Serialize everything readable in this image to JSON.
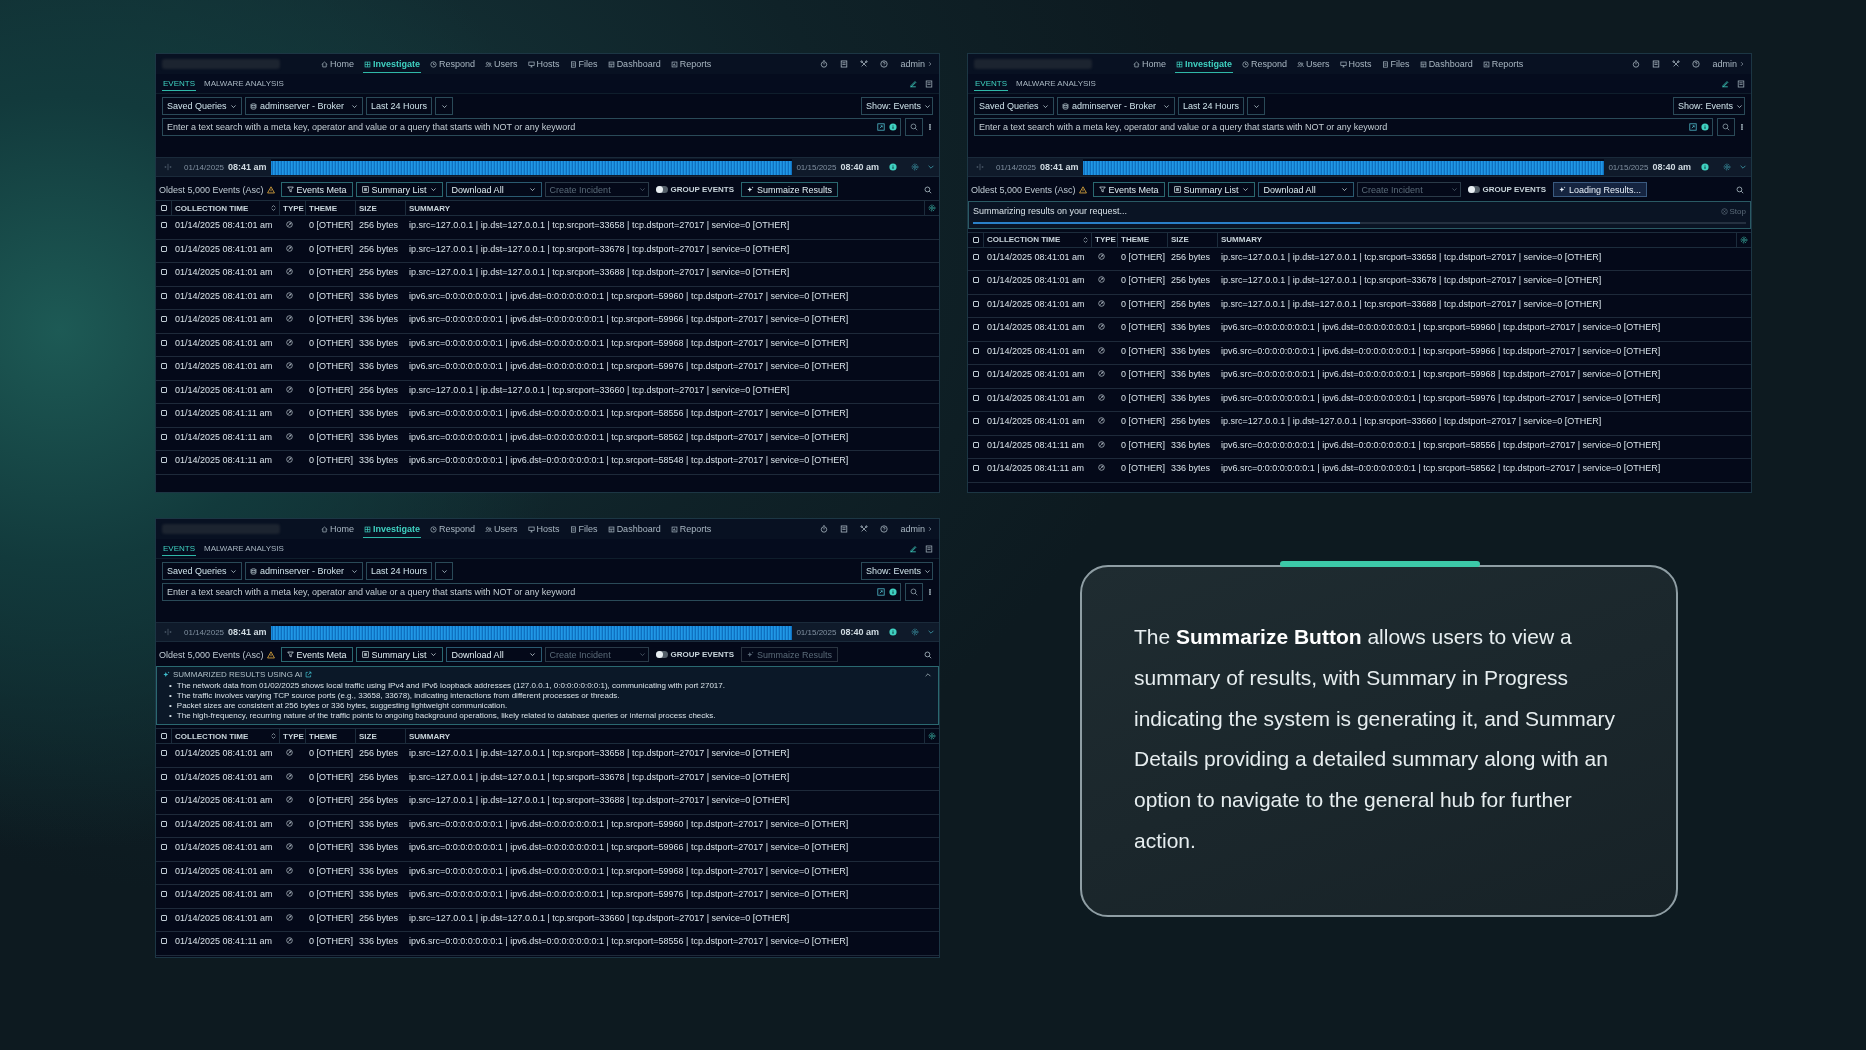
{
  "panels": [
    {
      "nav": {
        "items": [
          {
            "label": "Home",
            "selected": false
          },
          {
            "label": "Investigate",
            "selected": true
          },
          {
            "label": "Respond",
            "selected": false
          },
          {
            "label": "Users",
            "selected": false
          },
          {
            "label": "Hosts",
            "selected": false
          },
          {
            "label": "Files",
            "selected": false
          },
          {
            "label": "Dashboard",
            "selected": false
          },
          {
            "label": "Reports",
            "selected": false
          }
        ],
        "user": "admin"
      },
      "subtabs": [
        {
          "label": "EVENTS",
          "selected": true
        },
        {
          "label": "MALWARE ANALYSIS",
          "selected": false
        }
      ],
      "filters": {
        "saved_queries": "Saved Queries",
        "service": "adminserver - Broker",
        "range": "Last 24 Hours",
        "show": "Show: Events"
      },
      "search": {
        "placeholder": "Enter a text search with a meta key, operator and value or a query that starts with NOT or any keyword"
      },
      "timeline": {
        "start_date": "01/14/2025",
        "start_time": "08:41 am",
        "end_date": "01/15/2025",
        "end_time": "08:40 am"
      },
      "toolbar": {
        "count": "Oldest 5,000 Events (Asc)",
        "events_meta": "Events Meta",
        "summary_list": "Summary List",
        "download": "Download All",
        "incident_placeholder": "Create Incident",
        "group_events": {
          "label": "GROUP EVENTS",
          "on": false
        },
        "summarize": {
          "label": "Summaize Results",
          "kind": "idle"
        }
      },
      "select_all_checked": false,
      "columns": [
        "COLLECTION TIME",
        "TYPE",
        "THEME",
        "SIZE",
        "SUMMARY"
      ],
      "rows": [
        {
          "checked": false,
          "time": "01/14/2025 08:41:01 am",
          "theme": "0 [OTHER]",
          "size": "256 bytes",
          "summary": "ip.src=127.0.0.1 |  ip.dst=127.0.0.1 |  tcp.srcport=33658 |  tcp.dstport=27017 |  service=0 [OTHER]"
        },
        {
          "checked": false,
          "time": "01/14/2025 08:41:01 am",
          "theme": "0 [OTHER]",
          "size": "256 bytes",
          "summary": "ip.src=127.0.0.1 |  ip.dst=127.0.0.1 |  tcp.srcport=33678 |  tcp.dstport=27017 |  service=0 [OTHER]"
        },
        {
          "checked": false,
          "time": "01/14/2025 08:41:01 am",
          "theme": "0 [OTHER]",
          "size": "256 bytes",
          "summary": "ip.src=127.0.0.1 |  ip.dst=127.0.0.1 |  tcp.srcport=33688 |  tcp.dstport=27017 |  service=0 [OTHER]"
        },
        {
          "checked": false,
          "time": "01/14/2025 08:41:01 am",
          "theme": "0 [OTHER]",
          "size": "336 bytes",
          "summary": "ipv6.src=0:0:0:0:0:0:0:1 |  ipv6.dst=0:0:0:0:0:0:0:1 |  tcp.srcport=59960 |  tcp.dstport=27017 |  service=0 [OTHER]"
        },
        {
          "checked": false,
          "time": "01/14/2025 08:41:01 am",
          "theme": "0 [OTHER]",
          "size": "336 bytes",
          "summary": "ipv6.src=0:0:0:0:0:0:0:1 |  ipv6.dst=0:0:0:0:0:0:0:1 |  tcp.srcport=59966 |  tcp.dstport=27017 |  service=0 [OTHER]"
        },
        {
          "checked": false,
          "time": "01/14/2025 08:41:01 am",
          "theme": "0 [OTHER]",
          "size": "336 bytes",
          "summary": "ipv6.src=0:0:0:0:0:0:0:1 |  ipv6.dst=0:0:0:0:0:0:0:1 |  tcp.srcport=59968 |  tcp.dstport=27017 |  service=0 [OTHER]"
        },
        {
          "checked": false,
          "time": "01/14/2025 08:41:01 am",
          "theme": "0 [OTHER]",
          "size": "336 bytes",
          "summary": "ipv6.src=0:0:0:0:0:0:0:1 |  ipv6.dst=0:0:0:0:0:0:0:1 |  tcp.srcport=59976 |  tcp.dstport=27017 |  service=0 [OTHER]"
        },
        {
          "checked": false,
          "time": "01/14/2025 08:41:01 am",
          "theme": "0 [OTHER]",
          "size": "256 bytes",
          "summary": "ip.src=127.0.0.1 |  ip.dst=127.0.0.1 |  tcp.srcport=33660 |  tcp.dstport=27017 |  service=0 [OTHER]"
        },
        {
          "checked": false,
          "time": "01/14/2025 08:41:11 am",
          "theme": "0 [OTHER]",
          "size": "336 bytes",
          "summary": "ipv6.src=0:0:0:0:0:0:0:1 |  ipv6.dst=0:0:0:0:0:0:0:1 |  tcp.srcport=58556 |  tcp.dstport=27017 |  service=0 [OTHER]"
        },
        {
          "checked": false,
          "time": "01/14/2025 08:41:11 am",
          "theme": "0 [OTHER]",
          "size": "336 bytes",
          "summary": "ipv6.src=0:0:0:0:0:0:0:1 |  ipv6.dst=0:0:0:0:0:0:0:1 |  tcp.srcport=58562 |  tcp.dstport=27017 |  service=0 [OTHER]"
        },
        {
          "checked": false,
          "time": "01/14/2025 08:41:11 am",
          "theme": "0 [OTHER]",
          "size": "336 bytes",
          "summary": "ipv6.src=0:0:0:0:0:0:0:1 |  ipv6.dst=0:0:0:0:0:0:0:1 |  tcp.srcport=58548 |  tcp.dstport=27017 |  service=0 [OTHER]"
        }
      ]
    },
    {
      "nav": {
        "items": [
          {
            "label": "Home",
            "selected": false
          },
          {
            "label": "Investigate",
            "selected": true
          },
          {
            "label": "Respond",
            "selected": false
          },
          {
            "label": "Users",
            "selected": false
          },
          {
            "label": "Hosts",
            "selected": false
          },
          {
            "label": "Files",
            "selected": false
          },
          {
            "label": "Dashboard",
            "selected": false
          },
          {
            "label": "Reports",
            "selected": false
          }
        ],
        "user": "admin"
      },
      "subtabs": [
        {
          "label": "EVENTS",
          "selected": true
        },
        {
          "label": "MALWARE ANALYSIS",
          "selected": false
        }
      ],
      "filters": {
        "saved_queries": "Saved Queries",
        "service": "adminserver - Broker",
        "range": "Last 24 Hours",
        "show": "Show: Events"
      },
      "search": {
        "placeholder": "Enter a text search with a meta key, operator and value or a query that starts with NOT or any keyword"
      },
      "timeline": {
        "start_date": "01/14/2025",
        "start_time": "08:41 am",
        "end_date": "01/15/2025",
        "end_time": "08:40 am"
      },
      "toolbar": {
        "count": "Oldest 5,000 Events (Asc)",
        "events_meta": "Events Meta",
        "summary_list": "Summary List",
        "download": "Download All",
        "incident_placeholder": "Create Incident",
        "group_events": {
          "label": "GROUP EVENTS",
          "on": false
        },
        "summarize": {
          "label": "Loading Results...",
          "kind": "loading"
        }
      },
      "progress": {
        "message": "Summarizing results on your request...",
        "stop": "Stop",
        "level": 0.5
      },
      "select_all_checked": false,
      "columns": [
        "COLLECTION TIME",
        "TYPE",
        "THEME",
        "SIZE",
        "SUMMARY"
      ],
      "rows": [
        {
          "checked": false,
          "time": "01/14/2025 08:41:01 am",
          "theme": "0 [OTHER]",
          "size": "256 bytes",
          "summary": "ip.src=127.0.0.1 |  ip.dst=127.0.0.1 |  tcp.srcport=33658 |  tcp.dstport=27017 |  service=0 [OTHER]"
        },
        {
          "checked": false,
          "time": "01/14/2025 08:41:01 am",
          "theme": "0 [OTHER]",
          "size": "256 bytes",
          "summary": "ip.src=127.0.0.1 |  ip.dst=127.0.0.1 |  tcp.srcport=33678 |  tcp.dstport=27017 |  service=0 [OTHER]"
        },
        {
          "checked": false,
          "time": "01/14/2025 08:41:01 am",
          "theme": "0 [OTHER]",
          "size": "256 bytes",
          "summary": "ip.src=127.0.0.1 |  ip.dst=127.0.0.1 |  tcp.srcport=33688 |  tcp.dstport=27017 |  service=0 [OTHER]"
        },
        {
          "checked": false,
          "time": "01/14/2025 08:41:01 am",
          "theme": "0 [OTHER]",
          "size": "336 bytes",
          "summary": "ipv6.src=0:0:0:0:0:0:0:1 |  ipv6.dst=0:0:0:0:0:0:0:1 |  tcp.srcport=59960 |  tcp.dstport=27017 |  service=0 [OTHER]"
        },
        {
          "checked": false,
          "time": "01/14/2025 08:41:01 am",
          "theme": "0 [OTHER]",
          "size": "336 bytes",
          "summary": "ipv6.src=0:0:0:0:0:0:0:1 |  ipv6.dst=0:0:0:0:0:0:0:1 |  tcp.srcport=59966 |  tcp.dstport=27017 |  service=0 [OTHER]"
        },
        {
          "checked": false,
          "time": "01/14/2025 08:41:01 am",
          "theme": "0 [OTHER]",
          "size": "336 bytes",
          "summary": "ipv6.src=0:0:0:0:0:0:0:1 |  ipv6.dst=0:0:0:0:0:0:0:1 |  tcp.srcport=59968 |  tcp.dstport=27017 |  service=0 [OTHER]"
        },
        {
          "checked": false,
          "time": "01/14/2025 08:41:01 am",
          "theme": "0 [OTHER]",
          "size": "336 bytes",
          "summary": "ipv6.src=0:0:0:0:0:0:0:1 |  ipv6.dst=0:0:0:0:0:0:0:1 |  tcp.srcport=59976 |  tcp.dstport=27017 |  service=0 [OTHER]"
        },
        {
          "checked": false,
          "time": "01/14/2025 08:41:01 am",
          "theme": "0 [OTHER]",
          "size": "256 bytes",
          "summary": "ip.src=127.0.0.1 |  ip.dst=127.0.0.1 |  tcp.srcport=33660 |  tcp.dstport=27017 |  service=0 [OTHER]"
        },
        {
          "checked": false,
          "time": "01/14/2025 08:41:11 am",
          "theme": "0 [OTHER]",
          "size": "336 bytes",
          "summary": "ipv6.src=0:0:0:0:0:0:0:1 |  ipv6.dst=0:0:0:0:0:0:0:1 |  tcp.srcport=58556 |  tcp.dstport=27017 |  service=0 [OTHER]"
        },
        {
          "checked": false,
          "time": "01/14/2025 08:41:11 am",
          "theme": "0 [OTHER]",
          "size": "336 bytes",
          "summary": "ipv6.src=0:0:0:0:0:0:0:1 |  ipv6.dst=0:0:0:0:0:0:0:1 |  tcp.srcport=58562 |  tcp.dstport=27017 |  service=0 [OTHER]"
        }
      ]
    },
    {
      "nav": {
        "items": [
          {
            "label": "Home",
            "selected": false
          },
          {
            "label": "Investigate",
            "selected": true
          },
          {
            "label": "Respond",
            "selected": false
          },
          {
            "label": "Users",
            "selected": false
          },
          {
            "label": "Hosts",
            "selected": false
          },
          {
            "label": "Files",
            "selected": false
          },
          {
            "label": "Dashboard",
            "selected": false
          },
          {
            "label": "Reports",
            "selected": false
          }
        ],
        "user": "admin"
      },
      "subtabs": [
        {
          "label": "EVENTS",
          "selected": true
        },
        {
          "label": "MALWARE ANALYSIS",
          "selected": false
        }
      ],
      "filters": {
        "saved_queries": "Saved Queries",
        "service": "adminserver - Broker",
        "range": "Last 24 Hours",
        "show": "Show: Events"
      },
      "search": {
        "placeholder": "Enter a text search with a meta key, operator and value or a query that starts with NOT or any keyword"
      },
      "timeline": {
        "start_date": "01/14/2025",
        "start_time": "08:41 am",
        "end_date": "01/15/2025",
        "end_time": "08:40 am"
      },
      "toolbar": {
        "count": "Oldest 5,000 Events (Asc)",
        "events_meta": "Events Meta",
        "summary_list": "Summary List",
        "download": "Download All",
        "incident_placeholder": "Create Incident",
        "group_events": {
          "label": "GROUP EVENTS",
          "on": false
        },
        "summarize": {
          "label": "Summaize Results",
          "kind": "disabled"
        }
      },
      "ai_summary": {
        "title": "SUMMARIZED RESULTS USING AI",
        "expanded": true,
        "bullets": [
          {
            "marker": "•",
            "text": "The network data from 01/02/2025 shows local traffic using IPv4 and IPv6 loopback addresses (127.0.0.1, 0:0:0:0:0:0:0:1), communicating with port 27017."
          },
          {
            "marker": "•",
            "text": "The traffic involves varying TCP source ports (e.g., 33658, 33678), indicating interactions from different processes or threads."
          },
          {
            "marker": "•",
            "text": "Packet sizes are consistent at 256 bytes or 336 bytes, suggesting lightweight communication."
          },
          {
            "marker": "•",
            "text": "The high-frequency, recurring nature of the traffic points to ongoing background operations, likely related to database queries or internal process checks."
          }
        ]
      },
      "select_all_checked": false,
      "columns": [
        "COLLECTION TIME",
        "TYPE",
        "THEME",
        "SIZE",
        "SUMMARY"
      ],
      "rows": [
        {
          "checked": false,
          "time": "01/14/2025 08:41:01 am",
          "theme": "0 [OTHER]",
          "size": "256 bytes",
          "summary": "ip.src=127.0.0.1 |  ip.dst=127.0.0.1 |  tcp.srcport=33658 |  tcp.dstport=27017 |  service=0 [OTHER]"
        },
        {
          "checked": false,
          "time": "01/14/2025 08:41:01 am",
          "theme": "0 [OTHER]",
          "size": "256 bytes",
          "summary": "ip.src=127.0.0.1 |  ip.dst=127.0.0.1 |  tcp.srcport=33678 |  tcp.dstport=27017 |  service=0 [OTHER]"
        },
        {
          "checked": false,
          "time": "01/14/2025 08:41:01 am",
          "theme": "0 [OTHER]",
          "size": "256 bytes",
          "summary": "ip.src=127.0.0.1 |  ip.dst=127.0.0.1 |  tcp.srcport=33688 |  tcp.dstport=27017 |  service=0 [OTHER]"
        },
        {
          "checked": false,
          "time": "01/14/2025 08:41:01 am",
          "theme": "0 [OTHER]",
          "size": "336 bytes",
          "summary": "ipv6.src=0:0:0:0:0:0:0:1 |  ipv6.dst=0:0:0:0:0:0:0:1 |  tcp.srcport=59960 |  tcp.dstport=27017 |  service=0 [OTHER]"
        },
        {
          "checked": false,
          "time": "01/14/2025 08:41:01 am",
          "theme": "0 [OTHER]",
          "size": "336 bytes",
          "summary": "ipv6.src=0:0:0:0:0:0:0:1 |  ipv6.dst=0:0:0:0:0:0:0:1 |  tcp.srcport=59966 |  tcp.dstport=27017 |  service=0 [OTHER]"
        },
        {
          "checked": false,
          "time": "01/14/2025 08:41:01 am",
          "theme": "0 [OTHER]",
          "size": "336 bytes",
          "summary": "ipv6.src=0:0:0:0:0:0:0:1 |  ipv6.dst=0:0:0:0:0:0:0:1 |  tcp.srcport=59968 |  tcp.dstport=27017 |  service=0 [OTHER]"
        },
        {
          "checked": false,
          "time": "01/14/2025 08:41:01 am",
          "theme": "0 [OTHER]",
          "size": "336 bytes",
          "summary": "ipv6.src=0:0:0:0:0:0:0:1 |  ipv6.dst=0:0:0:0:0:0:0:1 |  tcp.srcport=59976 |  tcp.dstport=27017 |  service=0 [OTHER]"
        },
        {
          "checked": false,
          "time": "01/14/2025 08:41:01 am",
          "theme": "0 [OTHER]",
          "size": "256 bytes",
          "summary": "ip.src=127.0.0.1 |  ip.dst=127.0.0.1 |  tcp.srcport=33660 |  tcp.dstport=27017 |  service=0 [OTHER]"
        },
        {
          "checked": false,
          "time": "01/14/2025 08:41:11 am",
          "theme": "0 [OTHER]",
          "size": "336 bytes",
          "summary": "ipv6.src=0:0:0:0:0:0:0:1 |  ipv6.dst=0:0:0:0:0:0:0:1 |  tcp.srcport=58556 |  tcp.dstport=27017 |  service=0 [OTHER]"
        }
      ]
    }
  ],
  "card": {
    "text": "The **Summarize Button** allows users to view a summary of results, with Summary in Progress indicating the system is generating it, and Summary Details providing a detailed summary along with an option to navigate to the general hub for further action."
  }
}
